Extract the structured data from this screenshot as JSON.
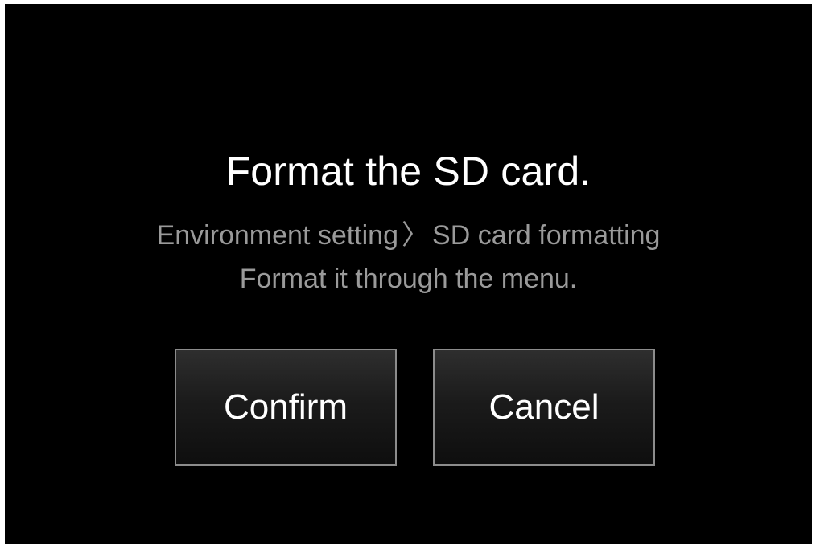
{
  "dialog": {
    "title": "Format the SD card.",
    "path_part1": "Environment setting",
    "path_separator": "〉",
    "path_part2": "SD card formatting",
    "instruction": "Format it through the menu."
  },
  "buttons": {
    "confirm_label": "Confirm",
    "cancel_label": "Cancel"
  },
  "colors": {
    "background": "#000000",
    "title_text": "#ffffff",
    "secondary_text": "#9a9a9a",
    "button_border": "#8c8c8c"
  }
}
